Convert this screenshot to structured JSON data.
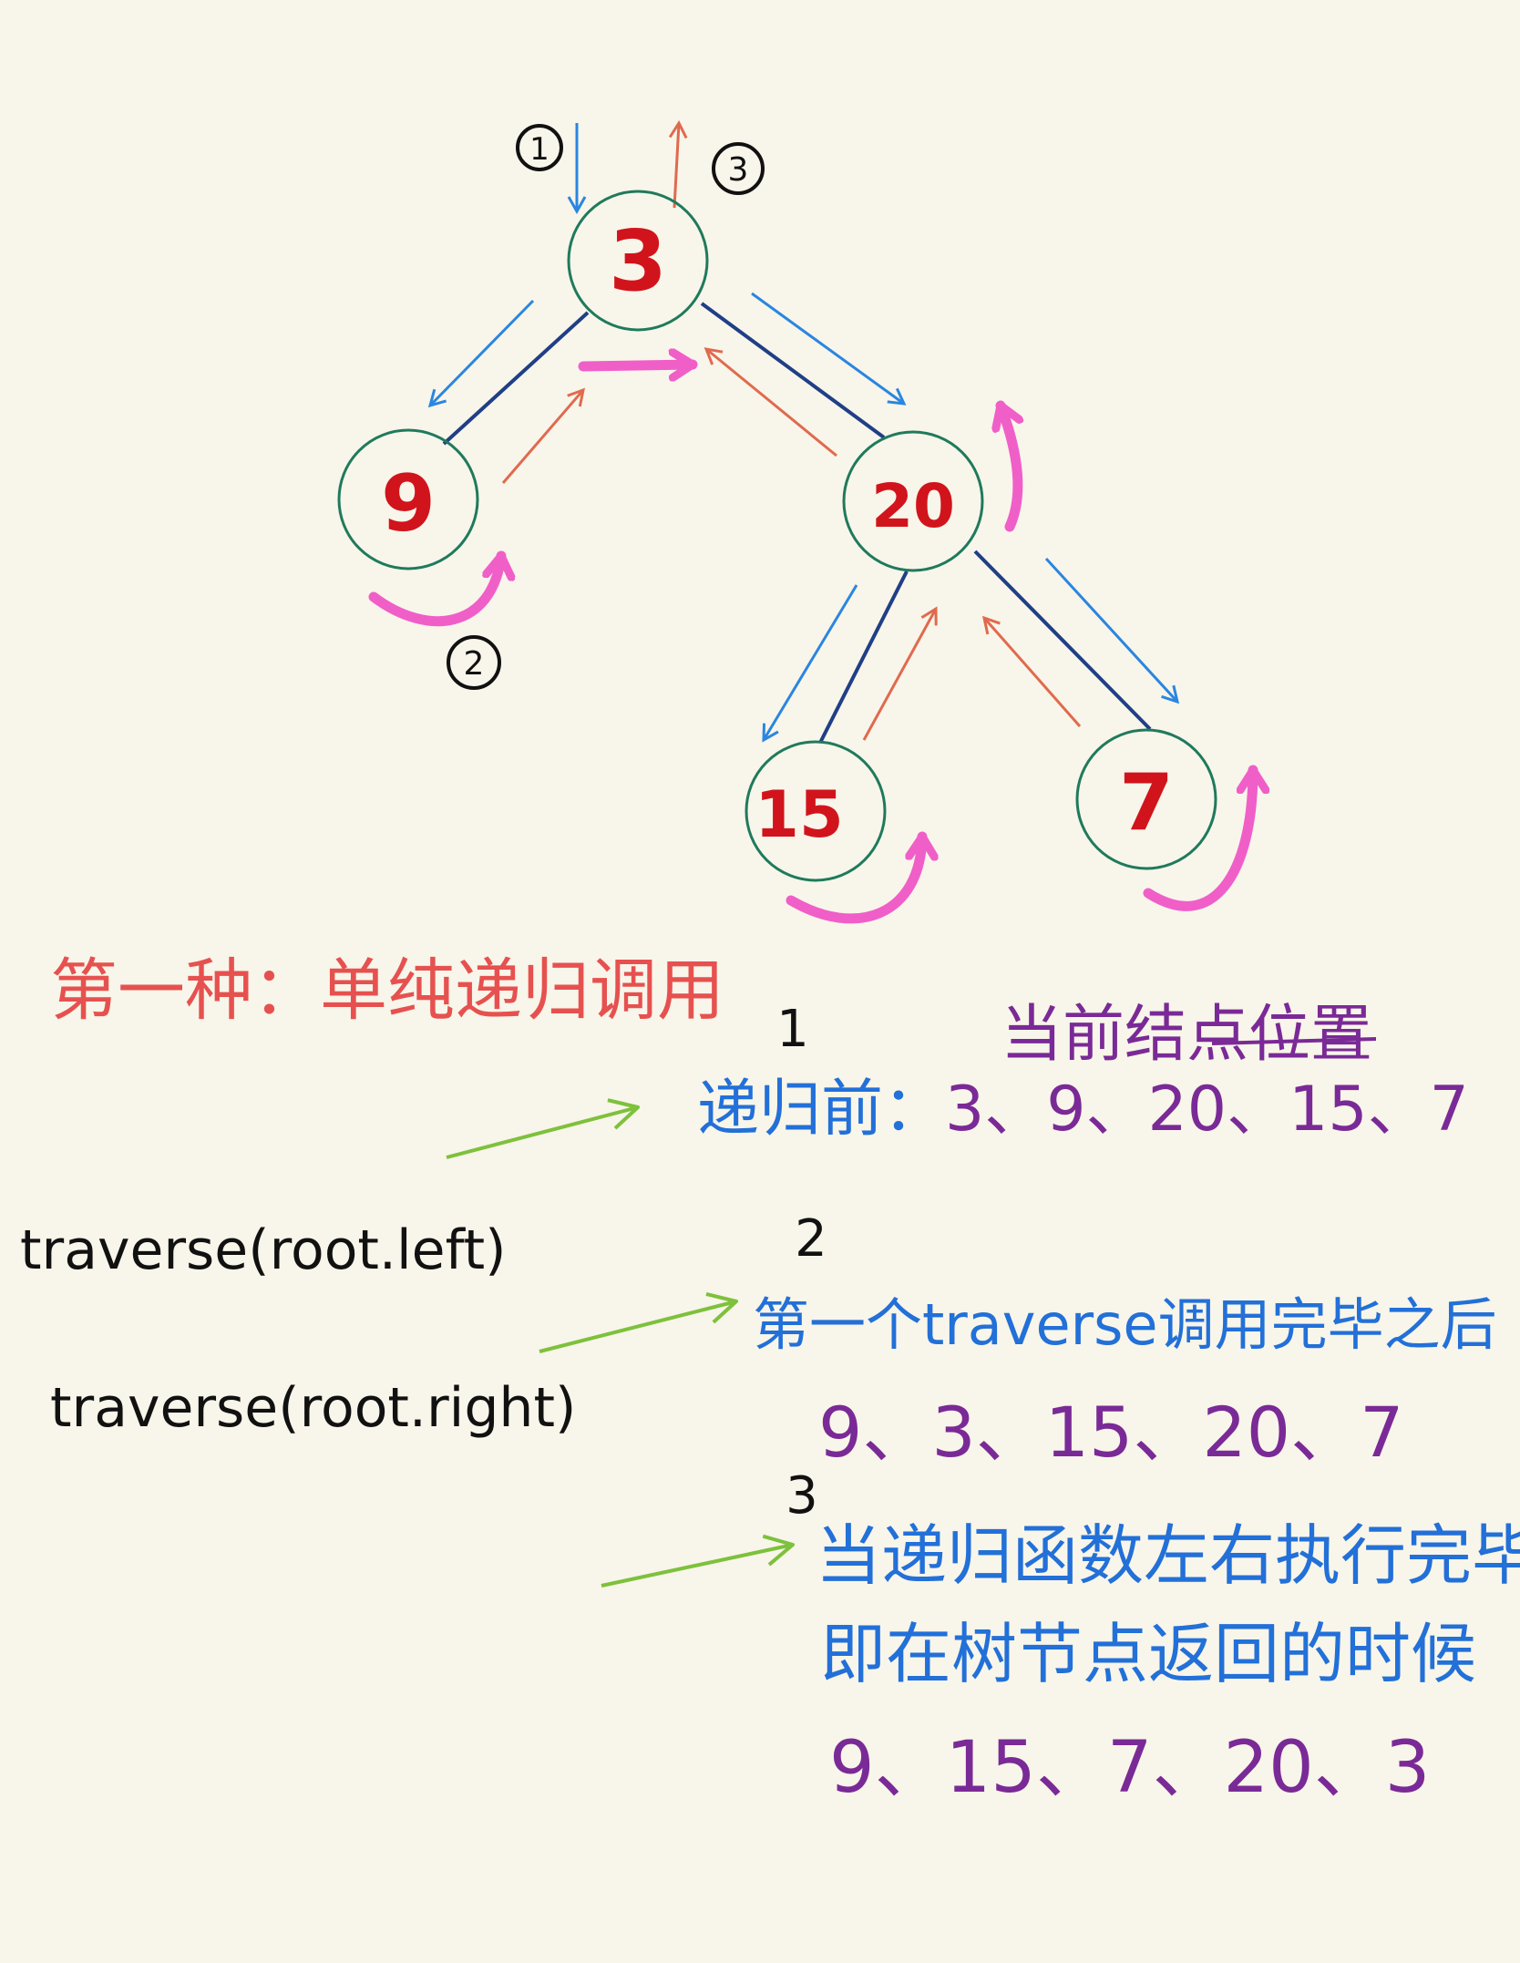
{
  "tree": {
    "nodes": [
      {
        "id": "n3",
        "label": "3"
      },
      {
        "id": "n9",
        "label": "9"
      },
      {
        "id": "n20",
        "label": "20"
      },
      {
        "id": "n15",
        "label": "15"
      },
      {
        "id": "n7",
        "label": "7"
      }
    ],
    "edges": [
      [
        "n3",
        "n9"
      ],
      [
        "n3",
        "n20"
      ],
      [
        "n20",
        "n15"
      ],
      [
        "n20",
        "n7"
      ]
    ]
  },
  "markers": {
    "m1": "1",
    "m2": "2",
    "m3": "3"
  },
  "text": {
    "heading": "第一种：单纯递归调用",
    "current_node_label": "当前结点位置",
    "pre_prefix": "递归前：",
    "pre_order": "3、9、20、15、7",
    "call_left": "traverse(root.left)",
    "call_right": "traverse(root.right)",
    "in_label": "第一个traverse调用完毕之后",
    "in_order": "9、3、15、20、7",
    "post_label_line1": "当递归函数左右执行完毕",
    "post_label_line2": "即在树节点返回的时候",
    "post_order": "9、15、7、20、3",
    "num1": "1",
    "num2": "2",
    "num3": "3"
  },
  "colors": {
    "background": "#f8f5ea",
    "node_border": "#1f7a5c",
    "node_label": "#d1141c",
    "edge": "#1f3f86",
    "descend_arrow": "#2a86e0",
    "ascend_arrow": "#e06a4e",
    "return_arrow": "#f05fc8",
    "pointer_arrow": "#7dc13c",
    "heading": "#e6514f",
    "blue_text": "#2270d8",
    "purple_text": "#7a2a96",
    "black_text": "#111111"
  }
}
